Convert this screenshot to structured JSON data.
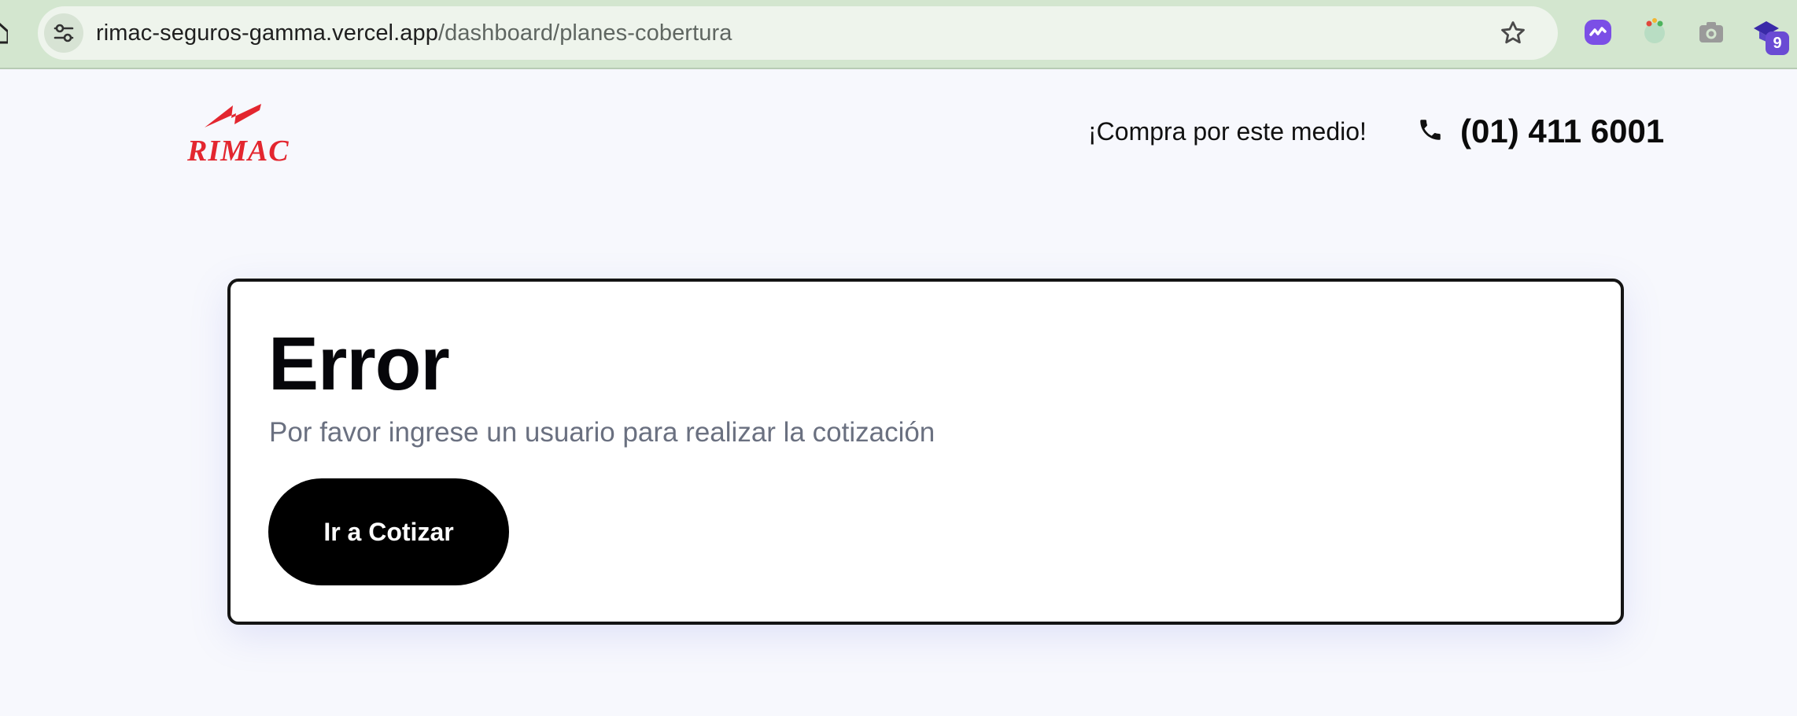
{
  "browser": {
    "url_host": "rimac-seguros-gamma.vercel.app",
    "url_path": "/dashboard/planes-cobertura",
    "extension_badge": "9"
  },
  "header": {
    "logo_text": "RIMAC",
    "promo_text": "¡Compra por este medio!",
    "phone": "(01) 411 6001"
  },
  "error_card": {
    "title": "Error",
    "message": "Por favor ingrese un usuario para realizar la cotización",
    "button_label": "Ir a Cotizar"
  },
  "colors": {
    "brand_red": "#e3262f",
    "button_bg": "#000000",
    "page_bg": "#f7f8fd",
    "browser_chrome": "#d3e6cf"
  },
  "icons": [
    "home-icon",
    "site-info-icon",
    "bookmark-star-icon",
    "extension-icon",
    "phone-icon"
  ]
}
